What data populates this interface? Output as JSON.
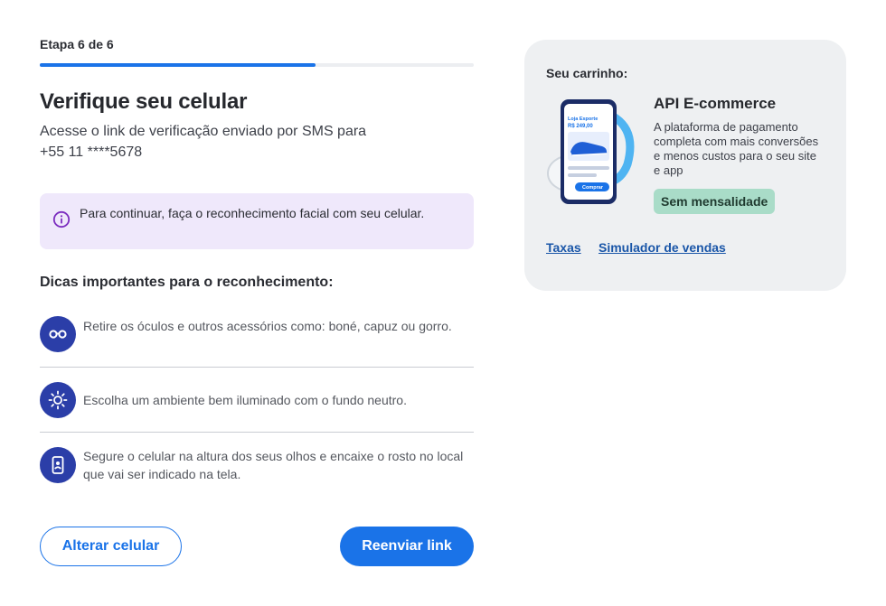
{
  "step": {
    "label": "Etapa 6 de 6",
    "progress_fraction": 0.635
  },
  "main": {
    "title": "Verifique seu celular",
    "subtitle_line1": "Acesse o link de verificação enviado por SMS para",
    "subtitle_line2": "+55 11 ****5678"
  },
  "info": {
    "icon": "info-icon",
    "text": "Para continuar, faça o reconhecimento facial com seu celular."
  },
  "tips": {
    "title": "Dicas importantes para o reconhecimento:",
    "items": [
      {
        "icon": "glasses-icon",
        "text": "Retire os óculos e outros acessórios como: boné, capuz ou gorro."
      },
      {
        "icon": "sun-icon",
        "text": "Escolha um ambiente bem iluminado com o fundo neutro."
      },
      {
        "icon": "phone-face-icon",
        "text": "Segure o celular na altura dos seus olhos e encaixe o rosto no local que vai ser indicado na tela."
      }
    ]
  },
  "buttons": {
    "change_phone": "Alterar celular",
    "resend_link": "Reenviar link"
  },
  "cart": {
    "label": "Seu carrinho:",
    "product_name": "API E-commerce",
    "product_description": "A plataforma de pagamento completa com mais conversões e menos custos para o seu site e app",
    "badge": "Sem mensalidade",
    "links": {
      "fees": "Taxas",
      "simulator": "Simulador de vendas"
    },
    "image_texts": {
      "store": "Loja Esporte",
      "price": "R$ 249,00",
      "buy": "Comprar"
    }
  },
  "colors": {
    "accent": "#1a73e8",
    "icon_bg": "#2b3ea8",
    "info_bg": "#efe8fb",
    "info_icon": "#7b2cbf",
    "badge_bg": "#a9dcc8",
    "cart_bg": "#eef0f2"
  }
}
